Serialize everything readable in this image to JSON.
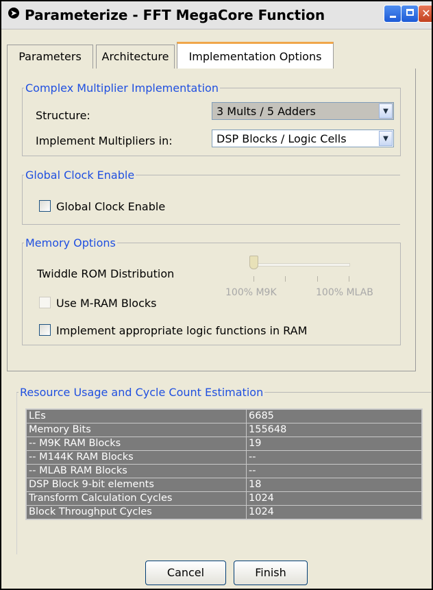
{
  "window": {
    "title": "Parameterize - FFT MegaCore Function",
    "icon": "circled-arrow-icon",
    "controls": [
      "minimize-icon",
      "maximize-icon",
      "close-icon"
    ]
  },
  "tabs": [
    {
      "label": "Parameters"
    },
    {
      "label": "Architecture"
    },
    {
      "label": "Implementation Options",
      "selected": true
    }
  ],
  "complex_multiplier": {
    "legend": "Complex Multiplier Implementation",
    "structure_label": "Structure:",
    "structure_value": "3 Mults / 5 Adders",
    "implement_label": "Implement Multipliers in:",
    "implement_value": "DSP Blocks / Logic Cells"
  },
  "global_clock": {
    "legend": "Global Clock Enable",
    "checkbox_label": "Global Clock Enable",
    "checked": false
  },
  "memory_options": {
    "legend": "Memory Options",
    "twiddle_label": "Twiddle ROM Distribution",
    "slider_left_label": "100% M9K",
    "slider_right_label": "100% MLAB",
    "slider_level": 0,
    "mram_label": "Use M-RAM Blocks",
    "mram_enabled": false,
    "ram_logic_label": "Implement appropriate logic functions in RAM",
    "ram_logic_checked": false
  },
  "resources": {
    "legend": "Resource Usage and Cycle Count Estimation",
    "rows": [
      {
        "name": "LEs",
        "value": "6685"
      },
      {
        "name": "Memory Bits",
        "value": "155648"
      },
      {
        "name": " -- M9K RAM Blocks",
        "value": "19"
      },
      {
        "name": " -- M144K RAM Blocks",
        "value": "--"
      },
      {
        "name": " -- MLAB RAM Blocks",
        "value": "--"
      },
      {
        "name": "DSP Block 9-bit elements",
        "value": "18"
      },
      {
        "name": "Transform Calculation Cycles",
        "value": "1024"
      },
      {
        "name": "Block Throughput Cycles",
        "value": "1024"
      }
    ]
  },
  "buttons": {
    "cancel": "Cancel",
    "finish": "Finish"
  },
  "colors": {
    "legend_text": "#1f4fe0",
    "active_tab_accent": "#f0a64a",
    "table_bg": "#7b7b7b",
    "close_button": "#c2401e"
  }
}
